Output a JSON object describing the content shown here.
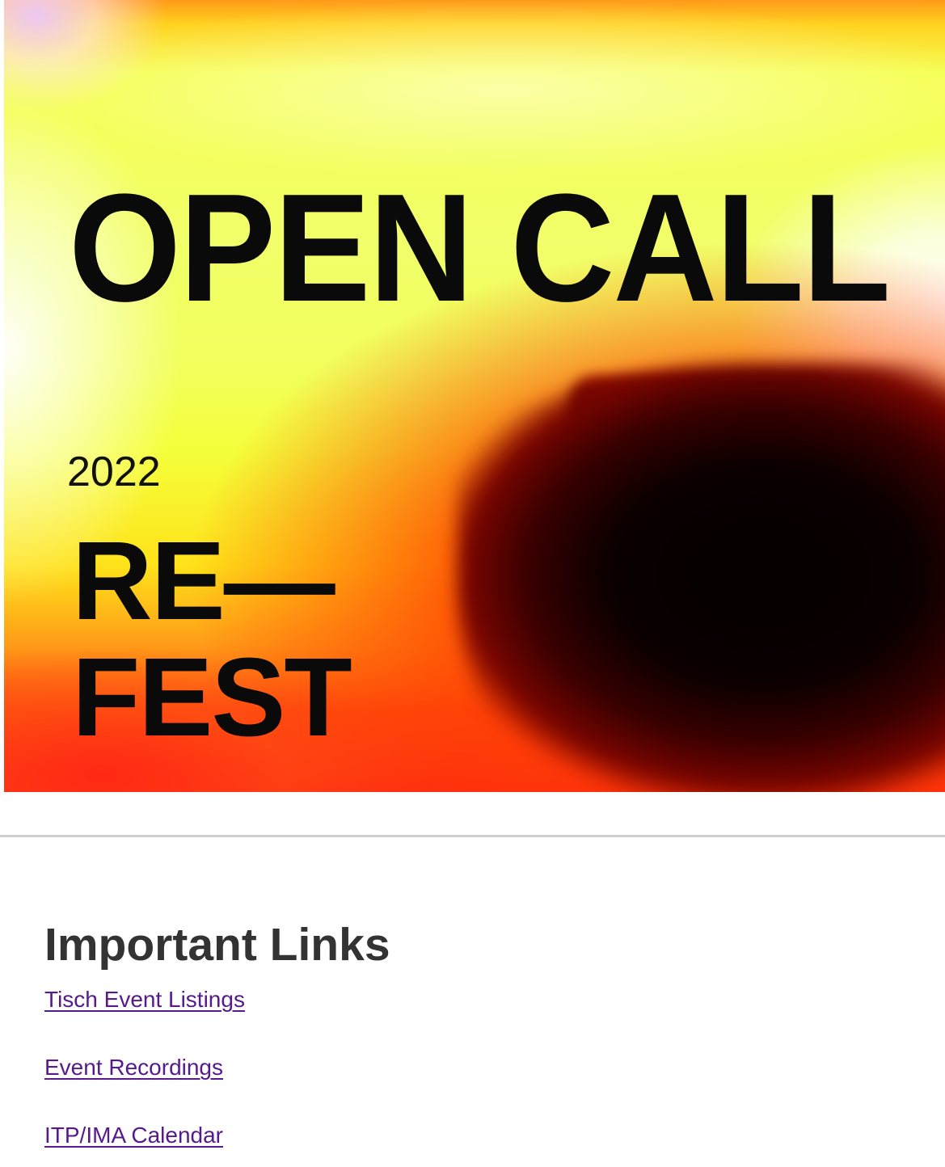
{
  "poster": {
    "headline": "OPEN CALL",
    "year": "2022",
    "title_line1": "RE—",
    "title_line2": "FEST"
  },
  "links": {
    "title": "Important Links",
    "items": [
      {
        "label": "Tisch Event Listings"
      },
      {
        "label": "Event Recordings"
      },
      {
        "label": "ITP/IMA Calendar"
      }
    ]
  },
  "colors": {
    "link": "#551a8b",
    "heading": "#333333",
    "divider": "#cfcfcf"
  }
}
